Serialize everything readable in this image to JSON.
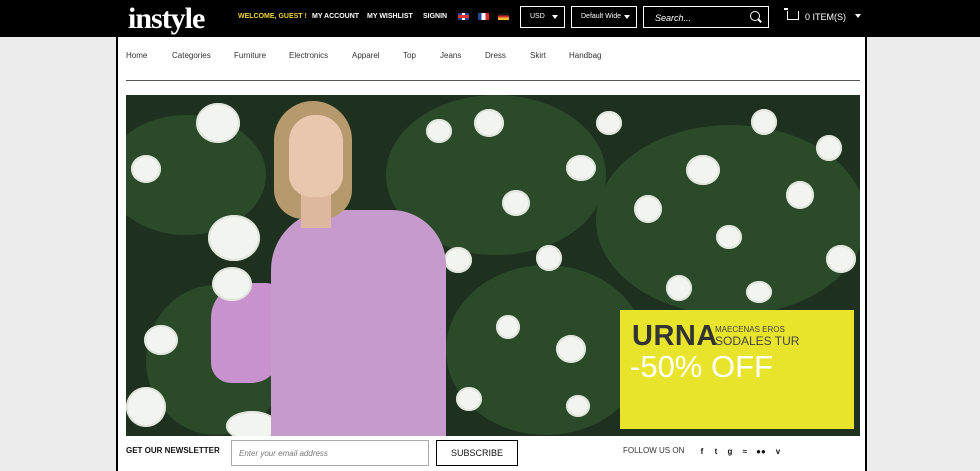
{
  "header": {
    "logo": "instyle",
    "welcome": "WELCOME, GUEST !",
    "my_account": "MY ACCOUNT",
    "my_wishlist": "MY WISHLIST",
    "signin": "SIGNIN",
    "languages": [
      "uk-flag-icon",
      "france-flag-icon",
      "germany-flag-icon"
    ],
    "currency": "USD",
    "layout": "Default Wide",
    "search_placeholder": "Search...",
    "cart_label": "0 ITEM(S)"
  },
  "nav": {
    "items": [
      "Home",
      "Categories",
      "Furniture",
      "Electronics",
      "Apparel",
      "Top",
      "Jeans",
      "Dress",
      "Skirt",
      "Handbag"
    ]
  },
  "banner": {
    "title": "URNA",
    "subtitle_line1": "MAECENAS EROS",
    "subtitle_line2": "SODALES TUR",
    "discount": "-50% OFF"
  },
  "footer": {
    "newsletter_label": "GET OUR NEWSLETTER",
    "email_placeholder": "Enter your email address",
    "subscribe": "SUBSCRIBE",
    "follow_label": "FOLLOW US ON",
    "social": [
      "f",
      "t",
      "g",
      "rss",
      "flickr",
      "v"
    ]
  },
  "colors": {
    "accent": "#f1d23a",
    "promo_bg": "#e8e42b",
    "topbar": "#000000"
  }
}
